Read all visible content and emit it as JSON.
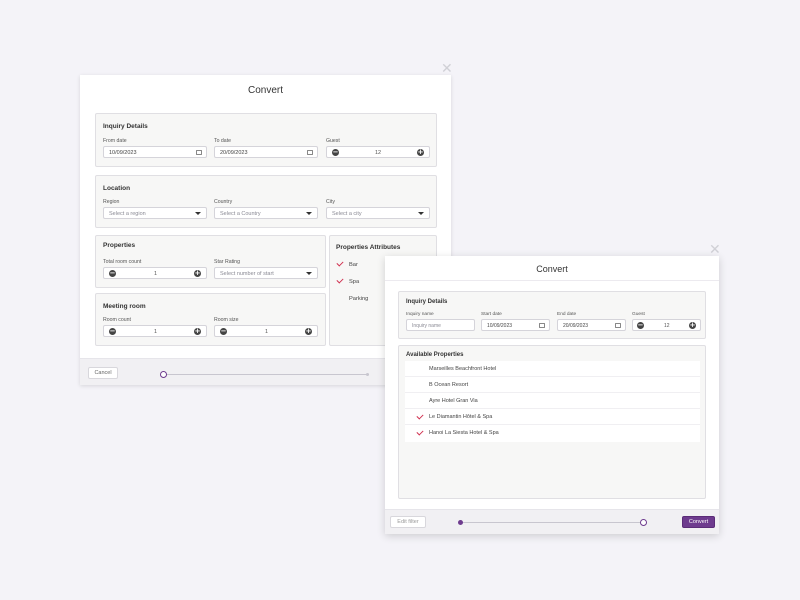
{
  "colors": {
    "accent": "#6e3b8e",
    "check": "#d0304f",
    "background": "#f4f3f8"
  },
  "dialog1": {
    "title": "Convert",
    "inquiry": {
      "title": "Inquiry Details",
      "from_label": "From date",
      "from_value": "10/09/2023",
      "to_label": "To date",
      "to_value": "20/09/2023",
      "guest_label": "Guest",
      "guest_value": "12"
    },
    "location": {
      "title": "Location",
      "region_label": "Region",
      "region_placeholder": "Select a region",
      "country_label": "Country",
      "country_placeholder": "Select a Country",
      "city_label": "City",
      "city_placeholder": "Select a city"
    },
    "properties": {
      "title": "Properties",
      "room_count_label": "Total room count",
      "room_count_value": "1",
      "star_label": "Star Rating",
      "star_placeholder": "Select number of start"
    },
    "meeting": {
      "title": "Meeting room",
      "room_count_label": "Room count",
      "room_count_value": "1",
      "room_size_label": "Room size",
      "room_size_value": "1"
    },
    "attributes": {
      "title": "Properties Attributes",
      "items": [
        {
          "label": "Bar",
          "checked": true
        },
        {
          "label": "Spa",
          "checked": true
        },
        {
          "label": "Parking",
          "checked": false
        }
      ]
    },
    "cancel_label": "Cancel",
    "progress_step": 1,
    "progress_total": 2
  },
  "dialog2": {
    "title": "Convert",
    "inquiry": {
      "title": "Inquiry Details",
      "name_label": "Inquiry name",
      "name_value": "Inquiry name",
      "start_label": "Start date",
      "start_value": "10/09/2023",
      "end_label": "End date",
      "end_value": "20/09/2023",
      "guest_label": "Guest",
      "guest_value": "12"
    },
    "available": {
      "title": "Available Properties",
      "items": [
        {
          "label": "Marseilles Beachfront Hotel",
          "checked": false
        },
        {
          "label": "B Ocean Resort",
          "checked": false
        },
        {
          "label": "Ayre Hotel Gran Via",
          "checked": false
        },
        {
          "label": "Le Diamantin Hôtel & Spa",
          "checked": true
        },
        {
          "label": "Hanoi La Siesta Hotel & Spa",
          "checked": true
        }
      ]
    },
    "edit_filter_label": "Edit filter",
    "convert_label": "Convert",
    "progress_step": 2,
    "progress_total": 2
  }
}
